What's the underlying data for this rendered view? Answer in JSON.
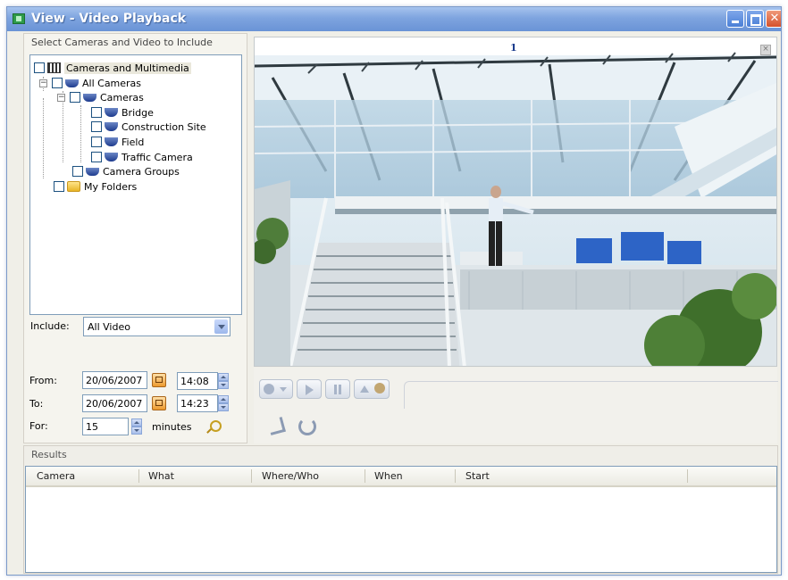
{
  "window": {
    "title": "View - Video Playback"
  },
  "selection": {
    "group_label": "Select Cameras and Video to Include",
    "tree": {
      "root": "Cameras and Multimedia",
      "all_cameras": "All Cameras",
      "cameras": "Cameras",
      "camera_items": [
        "Bridge",
        "Construction Site",
        "Field",
        "Traffic Camera"
      ],
      "camera_groups": "Camera Groups",
      "my_folders": "My Folders"
    }
  },
  "filters": {
    "include_label": "Include:",
    "include_value": "All Video",
    "from_label": "From:",
    "from_date": "20/06/2007",
    "from_time": "14:08",
    "to_label": "To:",
    "to_date": "20/06/2007",
    "to_time": "14:23",
    "for_label": "For:",
    "for_value": "15",
    "minutes_label": "minutes"
  },
  "video": {
    "pane_number": "1",
    "close_glyph": "×"
  },
  "results": {
    "label": "Results",
    "columns": [
      "Camera",
      "What",
      "Where/Who",
      "When",
      "Start"
    ]
  },
  "colors": {
    "title_bar": "#7ea4df",
    "close_button": "#d5512b",
    "tree_border": "#7f9db9"
  }
}
